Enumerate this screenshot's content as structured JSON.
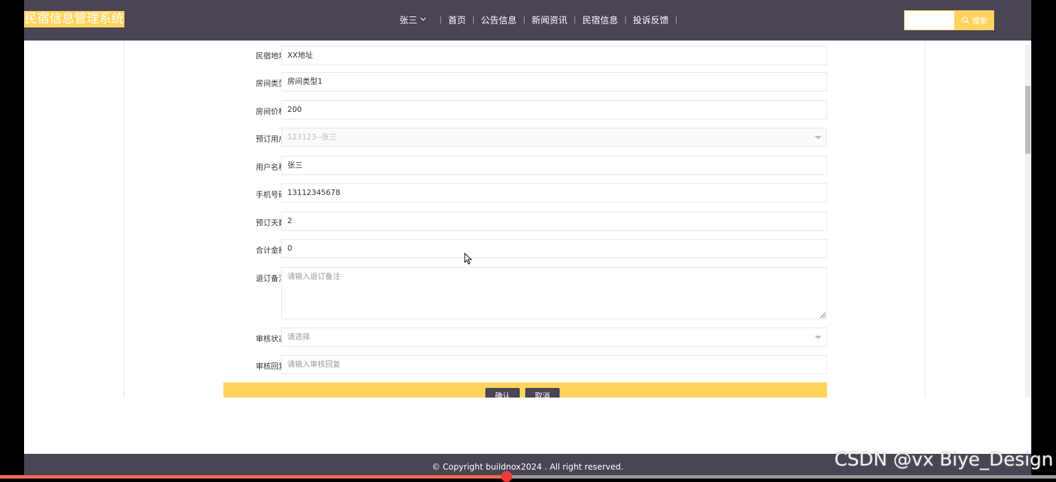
{
  "header": {
    "brand": "民宿信息管理系统",
    "user_name": "张三",
    "nav": [
      "首页",
      "公告信息",
      "新闻资讯",
      "民宿信息",
      "投诉反馈"
    ],
    "search_button": "搜索",
    "search_placeholder": ""
  },
  "form": {
    "fields": [
      {
        "label": "民宿地址",
        "value": ""
      },
      {
        "label": "房间类型",
        "value": "房间类型1"
      },
      {
        "label": "房间价格",
        "value": "200"
      },
      {
        "label": "预订用户",
        "value": "123123--张三"
      },
      {
        "label": "用户名称",
        "value": "张三"
      },
      {
        "label": "手机号码",
        "value": "13112345678"
      },
      {
        "label": "预订天数",
        "value": "2"
      },
      {
        "label": "合计金额",
        "value": "0"
      },
      {
        "label": "退订备注",
        "placeholder": "请输入退订备注"
      },
      {
        "label": "审核状态",
        "placeholder": "请选择"
      },
      {
        "label": "审核回复",
        "placeholder": "请输入审核回复"
      }
    ],
    "address_value": "XX地址",
    "confirm_button": "确认",
    "cancel_button": "取消"
  },
  "footer": {
    "copyright": "© Copyright buildnox2024 . All right reserved."
  },
  "watermark": "CSDN @vx  Biye_Design",
  "colors": {
    "header_bg": "#4a4453",
    "accent": "#ffd35c"
  }
}
